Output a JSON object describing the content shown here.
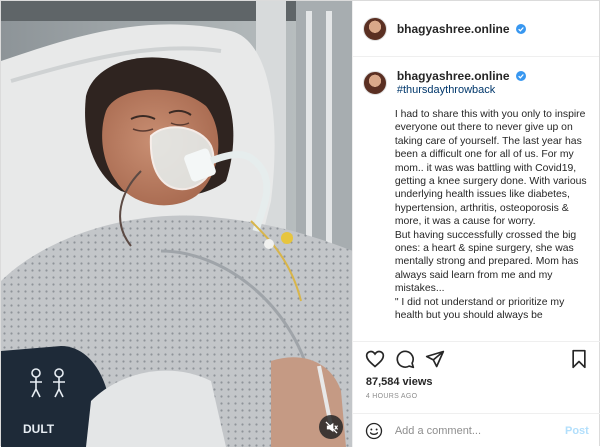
{
  "post": {
    "username": "bhagyashree.online",
    "hashtag": "#thursdaythrowback",
    "caption": "I had to share this with you only to inspire everyone out there to never give up on taking care of yourself. The last year has been a difficult one for all of us. For my mom.. it was was battling with Covid19, getting a knee surgery done. With various underlying health issues like diabetes, hypertension, arthritis, osteoporosis & more, it was a cause for worry.\nBut having successfully crossed the big ones: a heart & spine surgery, she was mentally strong and prepared. Mom has always said learn from me and my mistakes...\n\" I did not understand or prioritize my health but you should always be",
    "views": "87,584 views",
    "time": "4 HOURS AGO"
  },
  "media": {
    "cuff_label": "DULT"
  },
  "comment": {
    "placeholder": "Add a comment...",
    "post_label": "Post"
  },
  "icons": {
    "verified": "verified-badge-icon",
    "like": "heart-icon",
    "comment": "comment-icon",
    "share": "share-icon",
    "save": "bookmark-icon",
    "emoji": "smiley-icon",
    "mute": "muted-speaker-icon"
  },
  "colors": {
    "verified": "#3897f0",
    "post_button_disabled": "#b2dffc",
    "hashtag": "#00376b"
  }
}
